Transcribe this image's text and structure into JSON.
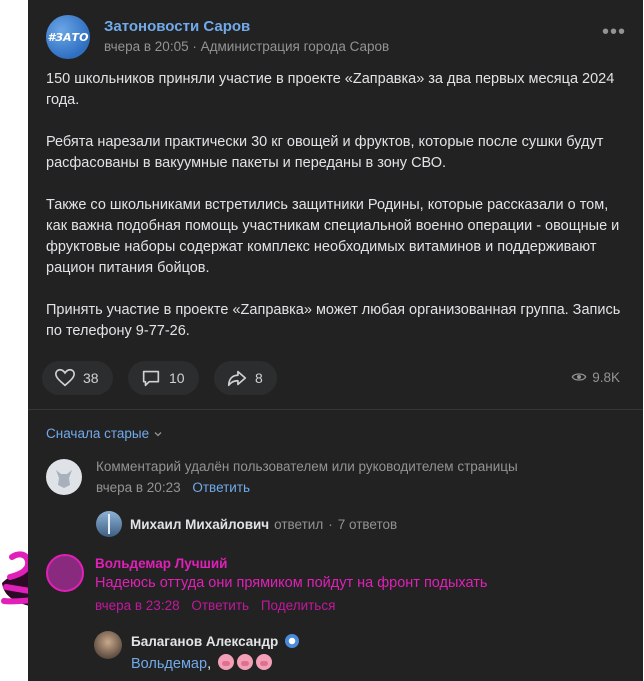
{
  "post": {
    "group_name": "Затоновости Саров",
    "avatar_text": "#ЗАТО",
    "time": "вчера в 20:05",
    "separator": "·",
    "author": "Администрация города Саров",
    "paragraphs": [
      "150 школьников приняли участие в проекте «Zаправка» за два первых месяца 2024 года.",
      "Ребята нарезали практически 30 кг овощей и фруктов, которые после сушки будут расфасованы в вакуумные пакеты и переданы в зону СВО.",
      "Также со школьниками встретились защитники Родины, которые рассказали о том, как важна подобная помощь участникам специальной военно операции - овощные и фруктовые наборы содержат комплекс необходимых витаминов и поддерживают рацион питания бойцов.",
      "Принять участие в проекте «Zаправка» может любая организованная группа. Запись по телефону 9-77-26."
    ],
    "likes": "38",
    "comments": "10",
    "shares": "8",
    "views": "9.8K"
  },
  "comments": {
    "sort_label": "Сначала старые",
    "deleted": {
      "text": "Комментарий удалён пользователем или руководителем страницы",
      "time": "вчера в 20:23",
      "reply_label": "Ответить"
    },
    "thread": {
      "name": "Михаил Михайлович",
      "action": "ответил",
      "separator": "·",
      "replies": "7 ответов"
    },
    "highlighted": {
      "name": "Вольдемар Лучший",
      "text": "Надеюсь оттуда они прямиком пойдут на фронт подыхать",
      "time": "вчера в 23:28",
      "reply_label": "Ответить",
      "share_label": "Поделиться"
    },
    "reply": {
      "name": "Балаганов Александр",
      "mention": "Вольдемар",
      "comma": ","
    }
  },
  "colors": {
    "accent": "#71aaeb",
    "highlight": "#e020b8",
    "background": "#222222"
  }
}
